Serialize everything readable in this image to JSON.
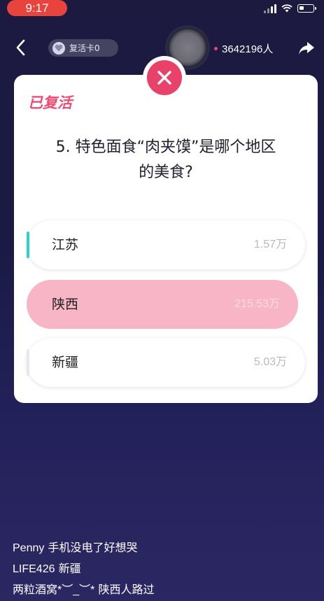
{
  "status_bar": {
    "time": "9:17"
  },
  "nav": {
    "revive_card_label": "复活卡0",
    "viewer_count": "3642196人"
  },
  "colors": {
    "accent": "#ef4b73",
    "selected_option": "#f7b5c6"
  },
  "card": {
    "revived_label": "已复活",
    "question_line1": "5. 特色面食“肉夹馍”是哪个地区",
    "question_line2": "的美食?",
    "options": [
      {
        "label": "江苏",
        "count": "1.57万",
        "selected": false
      },
      {
        "label": "陕西",
        "count": "215.53万",
        "selected": true
      },
      {
        "label": "新疆",
        "count": "5.03万",
        "selected": false
      }
    ]
  },
  "comments": [
    {
      "user": "Penny",
      "text": " 手机没电了好想哭"
    },
    {
      "user": "LIFE426",
      "text": " 新疆"
    },
    {
      "user": "两粒酒窝*︶_︶*",
      "text": " 陕西人路过"
    }
  ]
}
